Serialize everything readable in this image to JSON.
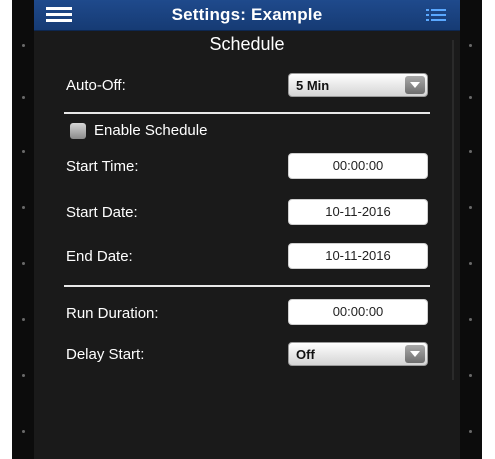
{
  "header": {
    "title": "Settings: Example"
  },
  "section_title": "Schedule",
  "auto_off": {
    "label": "Auto-Off:",
    "value": "5 Min"
  },
  "enable_schedule": {
    "label": "Enable Schedule",
    "checked": false
  },
  "start_time": {
    "label": "Start Time:",
    "value": "00:00:00"
  },
  "start_date": {
    "label": "Start Date:",
    "value": "10-11-2016"
  },
  "end_date": {
    "label": "End Date:",
    "value": "10-11-2016"
  },
  "run_duration": {
    "label": "Run Duration:",
    "value": "00:00:00"
  },
  "delay_start": {
    "label": "Delay Start:",
    "value": "Off"
  },
  "colors": {
    "header_bg": "#1f4a8c",
    "panel_bg": "#1a1a1a",
    "text": "#ffffff",
    "list_icon": "#5aa8ff"
  },
  "icons": [
    "hamburger-menu-icon",
    "list-icon",
    "dropdown-arrow-icon",
    "checkbox-icon"
  ]
}
